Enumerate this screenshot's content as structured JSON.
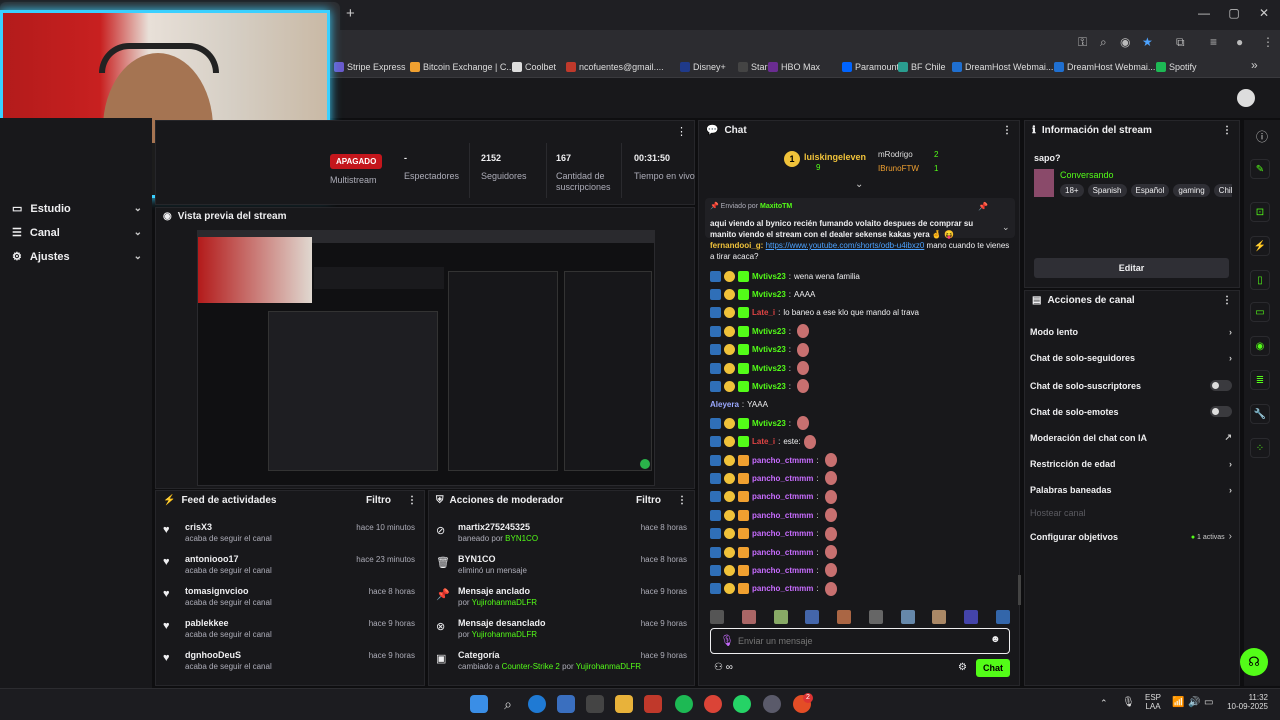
{
  "browser": {
    "bookmarks": [
      "Stripe Express",
      "Bitcoin Exchange | C...",
      "Coolbet",
      "ncofuentes@gmail....",
      "Disney+",
      "Star+",
      "HBO Max",
      "Paramount+",
      "BF Chile",
      "DreamHost Webmai...",
      "DreamHost Webmai...",
      "Spotify"
    ]
  },
  "nav": {
    "items": [
      {
        "label": "Estudio"
      },
      {
        "label": "Canal"
      },
      {
        "label": "Ajustes"
      }
    ]
  },
  "stats": {
    "status": "APAGADO",
    "multistream": "Multistream",
    "items": [
      {
        "value": "-",
        "label": "Espectadores"
      },
      {
        "value": "2152",
        "label": "Seguidores"
      },
      {
        "value": "167",
        "label": "Cantidad de suscripciones"
      },
      {
        "value": "00:31:50",
        "label": "Tiempo en vivo"
      }
    ]
  },
  "preview": {
    "title": "Vista previa del stream"
  },
  "activity": {
    "title": "Feed de actividades",
    "filter": "Filtro",
    "items": [
      {
        "name": "crisX3",
        "sub": "acaba de seguir el canal",
        "time": "hace 10 minutos"
      },
      {
        "name": "antoniooo17",
        "sub": "acaba de seguir el canal",
        "time": "hace 23 minutos"
      },
      {
        "name": "tomasignvcioo",
        "sub": "acaba de seguir el canal",
        "time": "hace 8 horas"
      },
      {
        "name": "pablekkee",
        "sub": "acaba de seguir el canal",
        "time": "hace 9 horas"
      },
      {
        "name": "dgnhooDeuS",
        "sub": "acaba de seguir el canal",
        "time": "hace 9 horas"
      }
    ]
  },
  "modactions": {
    "title": "Acciones de moderador",
    "filter": "Filtro",
    "items": [
      {
        "name": "martix275245325",
        "sub1": "baneado por ",
        "sub2": "BYN1CO",
        "sub3": "",
        "sub4": "",
        "time": "hace 8 horas"
      },
      {
        "name": "BYN1CO",
        "sub1": "eliminó un mensaje",
        "sub2": "",
        "sub3": "",
        "sub4": "",
        "time": "hace 8 horas"
      },
      {
        "name": "Mensaje anclado",
        "sub1": "por ",
        "sub2": "YujirohanmaDLFR",
        "sub3": "",
        "sub4": "",
        "time": "hace 9 horas"
      },
      {
        "name": "Mensaje desanclado",
        "sub1": "por ",
        "sub2": "YujirohanmaDLFR",
        "sub3": "",
        "sub4": "",
        "time": "hace 9 horas"
      },
      {
        "name": "Categoría",
        "sub1": "cambiado a ",
        "sub2": "Counter-Strike 2",
        "sub3": " por ",
        "sub4": "YujirohanmaDLFR",
        "time": "hace 9 horas"
      }
    ]
  },
  "chat": {
    "title": "Chat",
    "leaderboard": {
      "first": "luiskingeleven",
      "first_count": "9",
      "second": "mRodrigo",
      "second_count": "2",
      "third": "IBrunoFTW",
      "third_count": "1"
    },
    "pinned": {
      "label": "Enviado por",
      "user": "MaxitoTM",
      "text": "aqui viendo al bynico recién fumando volaito despues de comprar su manito viendo el stream con el dealer sekense kakas yera 🤞 😝"
    },
    "partial": {
      "user": "fernandooi_g:",
      "link": "https://www.youtube.com/shorts/odb-u4ibxz0",
      "text": " mano cuando te vienes a tirar acaca?"
    },
    "messages": [
      {
        "user": "Mvtivs23",
        "text": "wena wena familia",
        "color": "#53fc18"
      },
      {
        "user": "Mvtivs23",
        "text": "AAAA",
        "color": "#53fc18"
      },
      {
        "user": "Late_i",
        "text": "lo baneo a ese klo que mando al trava",
        "color": "#e04444"
      },
      {
        "user": "Mvtivs23",
        "text": "",
        "color": "#53fc18"
      },
      {
        "user": "Mvtivs23",
        "text": "",
        "color": "#53fc18"
      },
      {
        "user": "Mvtivs23",
        "text": "",
        "color": "#53fc18"
      },
      {
        "user": "Mvtivs23",
        "text": "",
        "color": "#53fc18"
      },
      {
        "user": "Aleyera",
        "text": "YAAA",
        "color": "#9aa8ff"
      },
      {
        "user": "Mvtivs23",
        "text": "",
        "color": "#53fc18"
      },
      {
        "user": "Late_i",
        "text": "este:",
        "color": "#e04444"
      },
      {
        "user": "pancho_ctmmm",
        "text": "",
        "color": "#c86cff"
      },
      {
        "user": "pancho_ctmmm",
        "text": "",
        "color": "#c86cff"
      },
      {
        "user": "pancho_ctmmm",
        "text": "",
        "color": "#c86cff"
      },
      {
        "user": "pancho_ctmmm",
        "text": "",
        "color": "#c86cff"
      },
      {
        "user": "pancho_ctmmm",
        "text": "",
        "color": "#c86cff"
      },
      {
        "user": "pancho_ctmmm",
        "text": "",
        "color": "#c86cff"
      },
      {
        "user": "pancho_ctmmm",
        "text": "",
        "color": "#c86cff"
      },
      {
        "user": "pancho_ctmmm",
        "text": "",
        "color": "#c86cff"
      }
    ],
    "input_placeholder": "Enviar un mensaje",
    "send": "Chat"
  },
  "streaminfo": {
    "title": "Información del stream",
    "stream_title": "sapo?",
    "category": "Conversando",
    "tags": [
      "18+",
      "Spanish",
      "Español",
      "gaming",
      "Chile"
    ],
    "edit": "Editar"
  },
  "channel_actions": {
    "title": "Acciones de canal",
    "items": [
      {
        "label": "Modo lento"
      },
      {
        "label": "Chat de solo-seguidores"
      },
      {
        "label": "Chat de solo-suscriptores"
      },
      {
        "label": "Chat de solo-emotes"
      },
      {
        "label": "Moderación del chat con IA"
      },
      {
        "label": "Restricción de edad"
      },
      {
        "label": "Palabras baneadas"
      },
      {
        "label": "Hostear canal"
      },
      {
        "label": "Configurar objetivos"
      }
    ],
    "goals_active": "1 activas"
  },
  "taskbar": {
    "lang1": "ESP",
    "lang2": "LAA",
    "time": "11:32",
    "date": "10-09-2025",
    "notif": "2"
  },
  "colors": {
    "accent": "#53fc18",
    "bg": "#0e0e10",
    "panel": "#18181b",
    "live_badge": "#c4161c"
  }
}
